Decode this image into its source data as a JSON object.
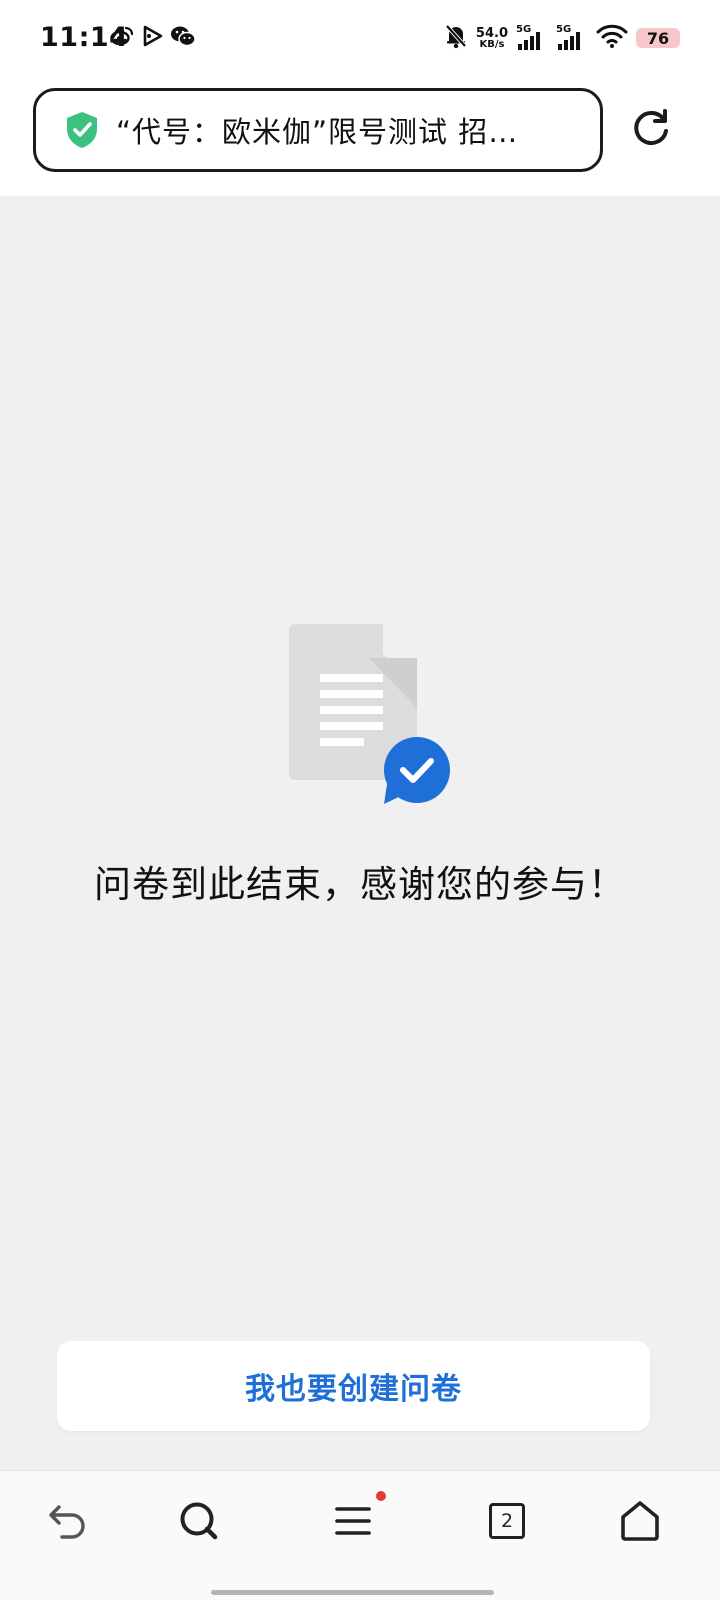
{
  "status_bar": {
    "time": "11:14",
    "net_speed_value": "54.0",
    "net_speed_unit": "KB/s",
    "sim1_label": "5G",
    "sim2_label": "5G",
    "battery": "76",
    "app_icons": [
      "weibo-icon",
      "video-play-icon",
      "wechat-icon"
    ],
    "status_icons": [
      "bell-off-icon",
      "wifi-icon"
    ]
  },
  "url_bar": {
    "title": "“代号：欧米伽”限号测试 招…",
    "secure_icon": "shield-check-icon",
    "secure_color": "#3cc27e",
    "reload_icon": "reload-icon"
  },
  "content": {
    "illustration_icon": "document-check-icon",
    "finish_message": "问卷到此结束，感谢您的参与！",
    "create_button_label": "我也要创建问卷",
    "accent_color": "#1f6fd8"
  },
  "bottom_nav": {
    "tabs_count": "2",
    "items": [
      "back-icon",
      "search-icon",
      "menu-icon",
      "tabs-icon",
      "home-icon"
    ],
    "menu_has_notification": true
  }
}
